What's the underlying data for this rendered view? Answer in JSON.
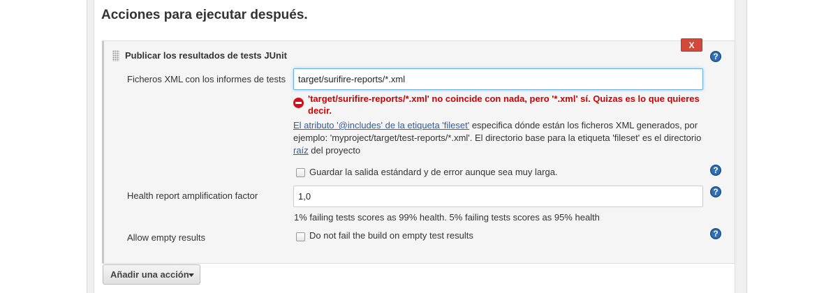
{
  "section_title": "Acciones para ejecutar después.",
  "step": {
    "title": "Publicar los resultados de tests JUnit",
    "delete_label": "X",
    "help_glyph": "?"
  },
  "test_results": {
    "label": "Ficheros XML con los informes de tests",
    "value": "target/surifire-reports/*.xml",
    "error": "'target/surifire-reports/*.xml' no coincide con nada, pero '*.xml' sí. Quizas es lo que quieres decir.",
    "help_link": "El atributo '@includes' de la etiqueta 'fileset'",
    "help_part1": " especifica dónde están los ficheros XML generados, por ejemplo: 'myproject/target/test-reports/*.xml'. El directorio base para la etiqueta 'fileset' es el directorio ",
    "help_link2": "raíz",
    "help_part2": " del proyecto"
  },
  "keep_long_stdio": {
    "label": "Guardar la salida estándard y de error aunque sea muy larga.",
    "checked": false
  },
  "health_scale": {
    "label": "Health report amplification factor",
    "value": "1,0",
    "hint": "1% failing tests scores as 99% health. 5% failing tests scores as 95% health"
  },
  "allow_empty": {
    "label": "Allow empty results",
    "checkbox_label": "Do not fail the build on empty test results",
    "checked": false
  },
  "add_action_label": "Añadir una acción",
  "icons": {
    "help": "help-icon",
    "error": "error-icon",
    "grip": "drag-handle-icon",
    "caret": "caret-down-icon"
  },
  "colors": {
    "delete_button": "#d24939",
    "error_text": "#cc0000",
    "help_icon": "#2f6fb3",
    "link": "#2f5e9e",
    "input_focus": "#66afe9"
  }
}
